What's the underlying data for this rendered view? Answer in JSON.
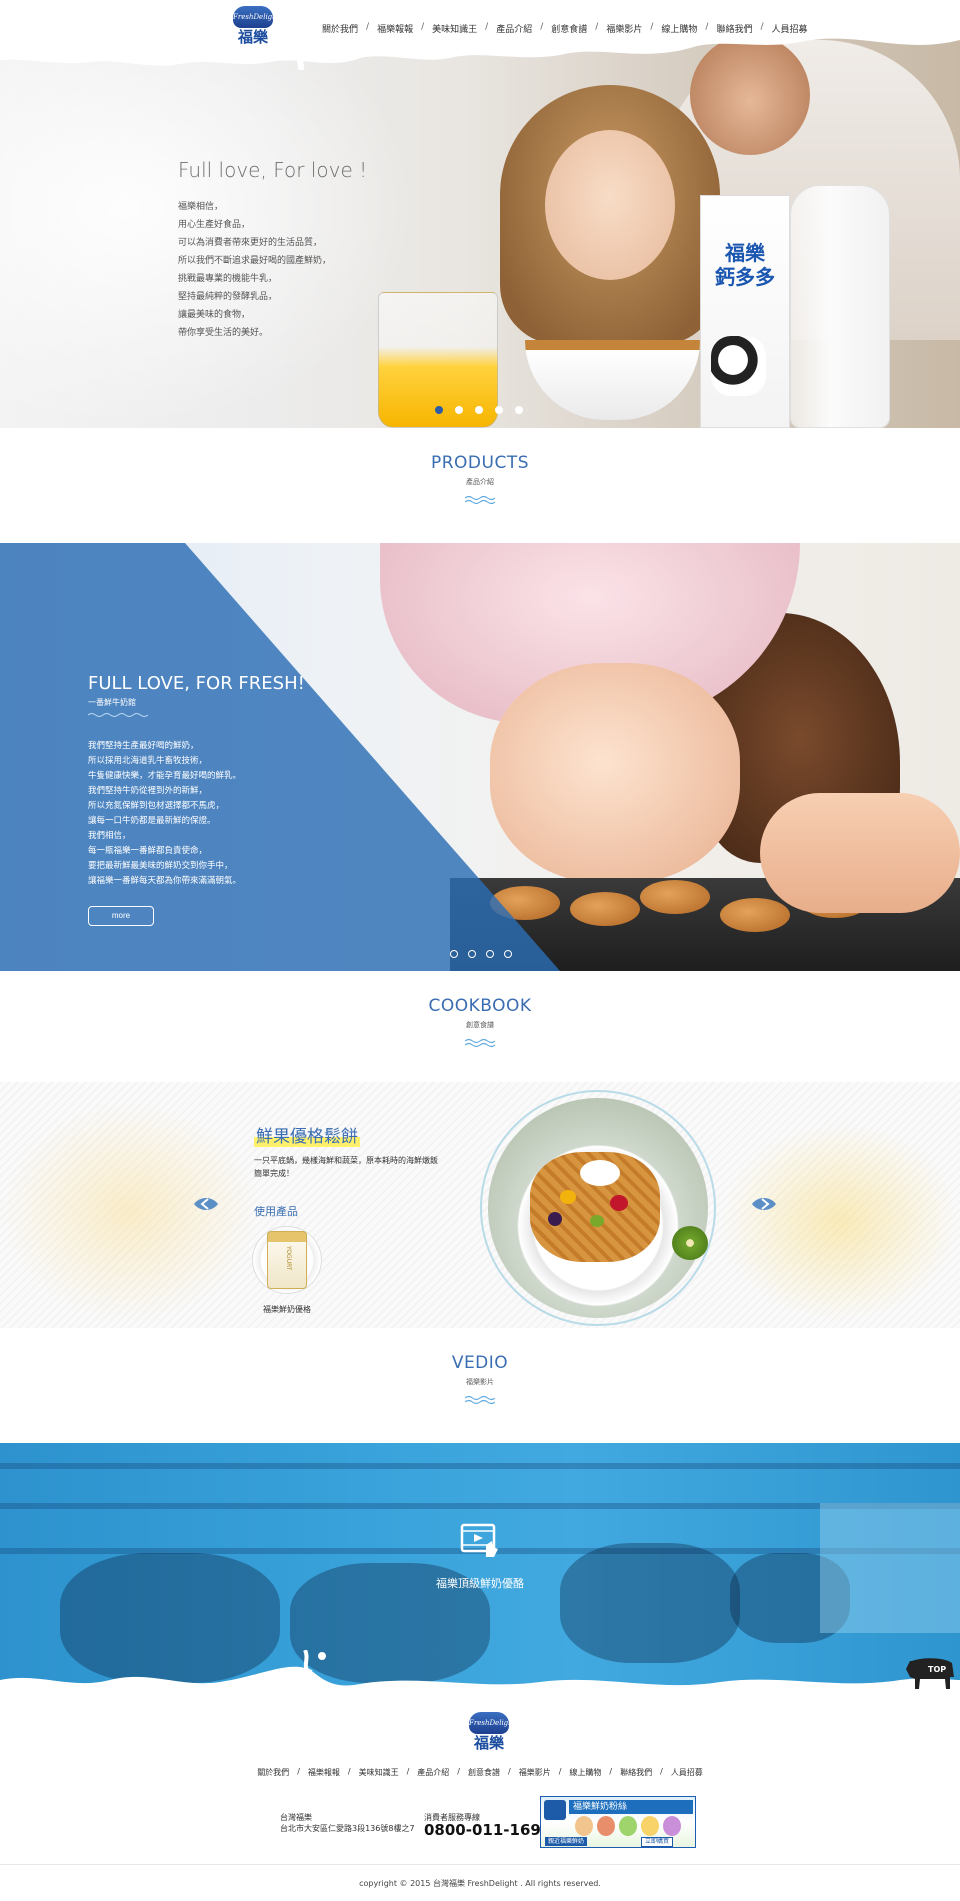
{
  "brand": {
    "logo_en": "FreshDelight",
    "logo_cn": "福樂"
  },
  "nav": [
    "關於我們",
    "福樂報報",
    "美味知識王",
    "產品介紹",
    "創意食譜",
    "福樂影片",
    "線上購物",
    "聯絡我們",
    "人員招募"
  ],
  "hero": {
    "title": "Full love, For love !",
    "lines": [
      "福樂相信，",
      "用心生產好食品，",
      "可以為消費者帶來更好的生活品質，",
      "所以我們不斷追求最好喝的國產鮮奶，",
      "挑戰最專業的機能牛乳，",
      "堅持最純粹的發酵乳品，",
      "讓最美味的食物，",
      "帶你享受生活的美好。"
    ],
    "carton_text": "福樂\n鈣多多",
    "dots": 5,
    "active_dot": 0
  },
  "products": {
    "title": "PRODUCTS",
    "subtitle": "產品介紹"
  },
  "fresh": {
    "title": "FULL LOVE, FOR FRESH!",
    "subtitle": "一番鮮牛奶館",
    "lines": [
      "我們堅持生產最好喝的鮮奶，",
      "所以採用北海道乳牛畜牧技術，",
      "牛隻健康快樂，才能孕育最好喝的鮮乳。",
      "我們堅持牛奶從裡到外的新鮮，",
      "所以充氮保鮮到包材選擇都不馬虎，",
      "讓每一口牛奶都是最新鮮的保證。",
      "我們相信，",
      "每一瓶福樂一番鮮都負責使命，",
      "要把最新鮮最美味的鮮奶交到你手中，",
      "讓福樂一番鮮每天都為你帶來滿滿朝氣。"
    ],
    "more_label": "more",
    "dots": 4
  },
  "cookbook": {
    "title": "COOKBOOK",
    "subtitle": "創意食譜",
    "recipe_title": "鮮果優格鬆餅",
    "recipe_desc": "一只平底鍋，幾樣海鮮和蔬菜，原本耗時的海鮮燉飯簡單完成！",
    "use_label": "使用產品",
    "product_name": "福樂鮮奶優格",
    "cup_text": "YOGURT"
  },
  "video": {
    "title": "VEDIO",
    "subtitle": "福樂影片",
    "label": "福樂頂級鮮奶優酪"
  },
  "top_label": "TOP",
  "footer": {
    "nav": [
      "關於我們",
      "福樂報報",
      "美味知識王",
      "產品介紹",
      "創意食譜",
      "福樂影片",
      "線上購物",
      "聯絡我們",
      "人員招募"
    ],
    "company": "台灣福樂",
    "address": "台北市大安區仁愛路3段136號8樓之7",
    "hotline_label": "消費者服務專線",
    "hotline": "0800-011-169",
    "banner_title": "福樂鮮奶粉絲",
    "banner_left": "親近福樂鮮奶",
    "banner_right": "立即購買",
    "copyright": "copyright © 2015 台灣福樂 FreshDelight . All rights reserved."
  },
  "colors": {
    "brand_blue": "#3a6db1",
    "video_blue": "#3aa3db",
    "active_dot": "#2a5aa8"
  }
}
